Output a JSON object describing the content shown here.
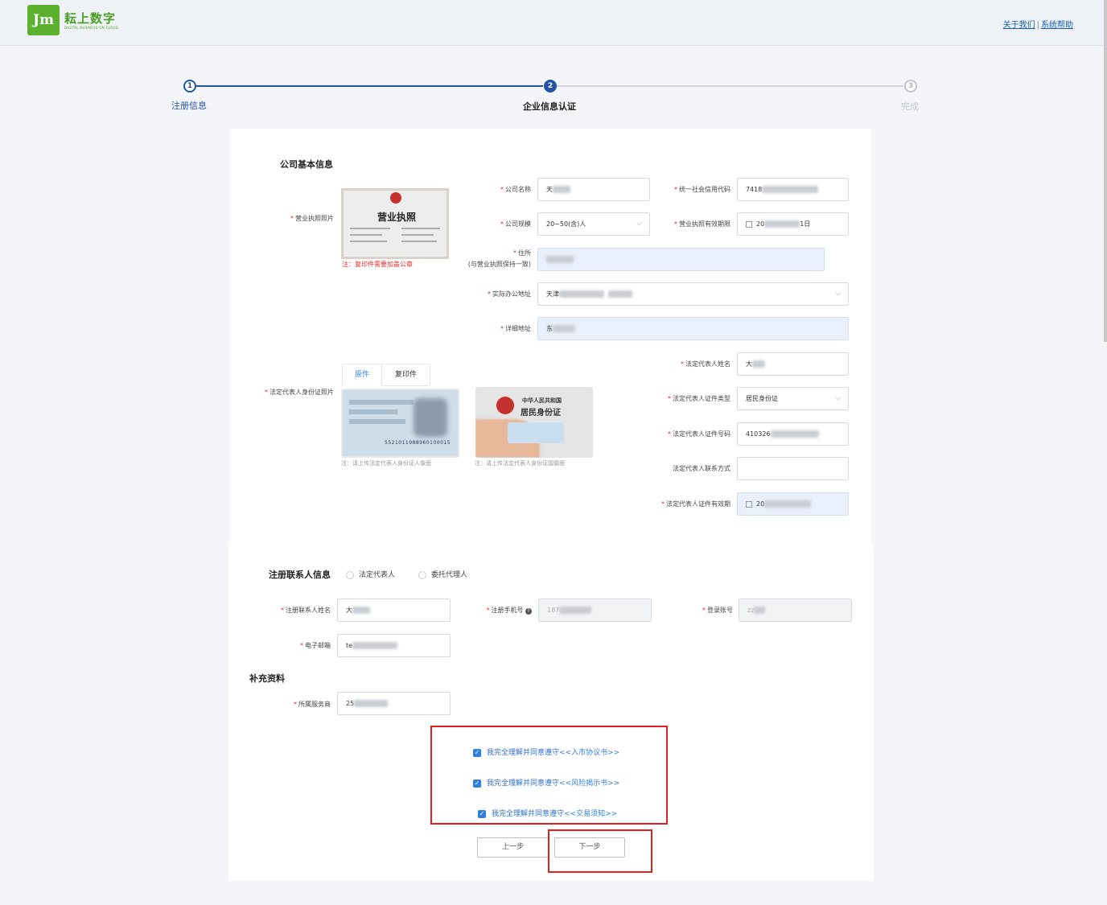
{
  "header": {
    "logo_glyph": "Jm",
    "brand": "耘上数字",
    "brand_sub": "DIGITAL BUSINESS ON CLOUD",
    "links": [
      "关于我们",
      "系统帮助"
    ],
    "link_sep": "|"
  },
  "steps": [
    {
      "num": "1",
      "label": "注册信息",
      "state": "done"
    },
    {
      "num": "2",
      "label": "企业信息认证",
      "state": "active"
    },
    {
      "num": "3",
      "label": "完成",
      "state": "pending"
    }
  ],
  "company": {
    "section_title": "公司基本信息",
    "license_label": "营业执照照片",
    "license_title": "营业执照",
    "license_note": "注：复印件需要加盖公章",
    "name_label": "公司名称",
    "name_value": "天",
    "credit_label": "统一社会信用代码",
    "credit_value": "7418",
    "scale_label": "公司规模",
    "scale_value": "20~50(含)人",
    "license_validity_label": "营业执照有效期限",
    "license_validity_value_a": "20",
    "license_validity_value_b": "1日",
    "address_label": "住所",
    "address_hint": "(与营业执照保持一致)",
    "office_label": "实际办公地址",
    "office_value": "天津",
    "detail_label": "详细地址",
    "detail_value": "东"
  },
  "legal": {
    "id_photo_label": "法定代表人身份证照片",
    "tab_original": "原件",
    "tab_copy": "复印件",
    "front_number": "5521011988960100015",
    "back_title_1": "中华人民共和国",
    "back_title_2": "居民身份证",
    "front_note": "注：请上传法定代表人身份证人像面",
    "back_note": "注：请上传法定代表人身份证国徽面",
    "name_label": "法定代表人姓名",
    "name_value": "大",
    "id_type_label": "法定代表人证件类型",
    "id_type_value": "居民身份证",
    "id_number_label": "法定代表人证件号码",
    "id_number_value": "410326",
    "contact_label": "法定代表人联系方式",
    "contact_value": "",
    "id_validity_label": "法定代表人证件有效期",
    "id_validity_value": "20"
  },
  "contact": {
    "section_title": "注册联系人信息",
    "radio_legal": "法定代表人",
    "radio_agent": "委托代理人",
    "name_label": "注册联系人姓名",
    "name_value": "大",
    "phone_label": "注册手机号",
    "phone_value": "187",
    "account_label": "登录账号",
    "account_value": "zz",
    "email_label": "电子邮箱",
    "email_value": "te"
  },
  "supplement": {
    "section_title": "补充资料",
    "provider_label": "所属服务商",
    "provider_value": "25"
  },
  "agreements": [
    {
      "text": "我完全理解并同意遵守",
      "doc": "<<入市协议书>>",
      "checked": true
    },
    {
      "text": "我完全理解并同意遵守",
      "doc": "<<风险揭示书>>",
      "checked": true
    },
    {
      "text": "我完全理解并同意遵守",
      "doc": "<<交易须知>>",
      "checked": true
    }
  ],
  "buttons": {
    "prev": "上一步",
    "next": "下一步"
  },
  "colors": {
    "brand_green": "#5bb12e",
    "step_blue": "#2453a6",
    "required_red": "#e0302f",
    "highlight_red": "#e02020",
    "checkbox_blue": "#2f7fdf"
  }
}
